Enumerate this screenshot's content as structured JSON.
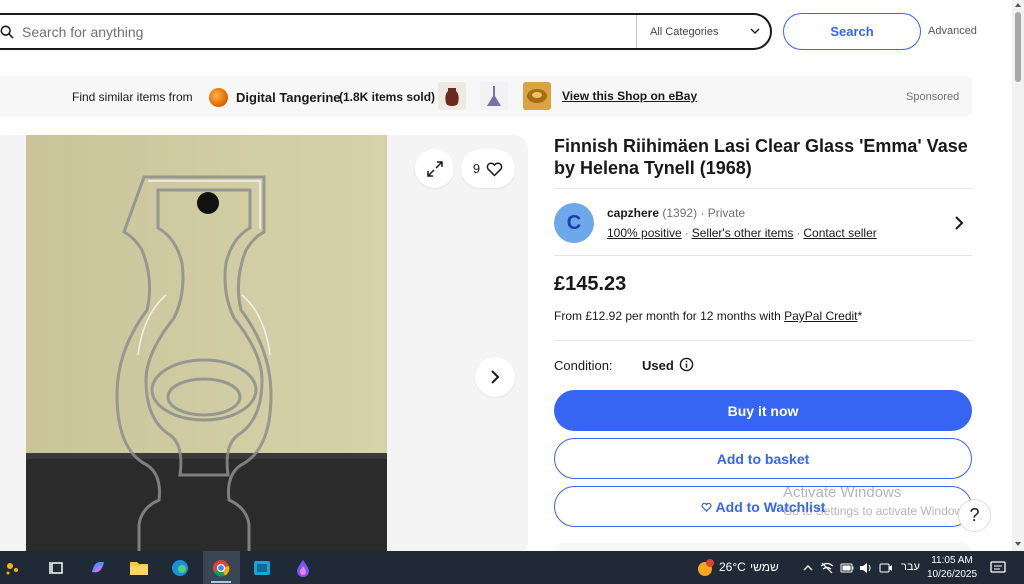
{
  "search": {
    "placeholder": "Search for anything",
    "category": "All Categories",
    "button": "Search",
    "advanced": "Advanced"
  },
  "banner": {
    "prefix": "Find similar items from",
    "shop_name": "Digital Tangerine",
    "sold": "(1.8K items sold)",
    "view_shop": "View this Shop on eBay",
    "sponsored": "Sponsored"
  },
  "gallery": {
    "watch_count": "9"
  },
  "listing": {
    "title": "Finnish Riihimäen Lasi Clear Glass 'Emma' Vase by Helena Tynell (1968)",
    "seller": {
      "initial": "C",
      "name": "capzhere",
      "feedback": "(1392)",
      "type": "Private",
      "positive": "100% positive",
      "other_items": "Seller's other items",
      "contact": "Contact seller"
    },
    "price": "£145.23",
    "finance_prefix": "From £12.92 per month for 12 months with",
    "finance_link": "PayPal Credit",
    "finance_suffix": "*",
    "condition_label": "Condition:",
    "condition_value": "Used",
    "buy_now": "Buy it now",
    "add_basket": "Add to basket",
    "add_watchlist": "Add to Watchlist"
  },
  "watermark": {
    "line1": "Activate Windows",
    "line2": "Go to Settings to activate Windows."
  },
  "help": "?",
  "taskbar": {
    "temperature": "26°C",
    "weather_text": "שמשי",
    "language": "עבר",
    "time": "11:05 AM",
    "date": "10/26/2025",
    "weather_badge": "1"
  },
  "colors": {
    "accent": "#3665f3",
    "taskbar": "#1f2a36"
  }
}
